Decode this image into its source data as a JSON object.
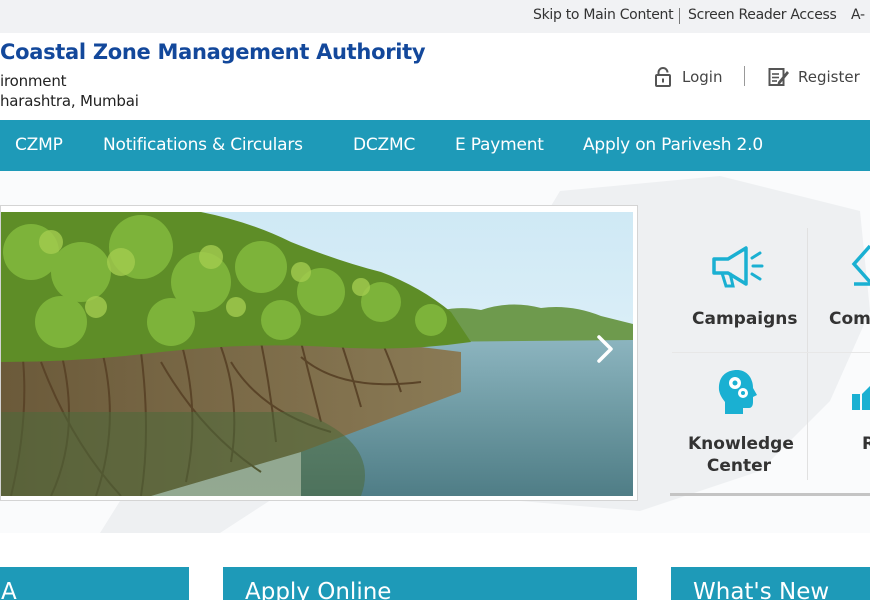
{
  "topbar": {
    "skip_link": "Skip to Main Content",
    "screen_reader": "Screen Reader Access",
    "font_decrease": "A-"
  },
  "header": {
    "title": "Coastal Zone Management Authority",
    "subtitle_1": "ironment",
    "subtitle_2": "harashtra, Mumbai",
    "login_label": "Login",
    "register_label": "Register",
    "icons": {
      "login": "lock-icon",
      "register": "register-note-icon"
    }
  },
  "nav": {
    "items": [
      {
        "label": "CZMP"
      },
      {
        "label": "Notifications & Circulars"
      },
      {
        "label": "DCZMC"
      },
      {
        "label": "E Payment"
      },
      {
        "label": "Apply on Parivesh 2.0"
      }
    ]
  },
  "slider": {
    "next_icon": "chevron-right-icon"
  },
  "quick_links": [
    {
      "label": "Campaigns",
      "icon": "megaphone-icon"
    },
    {
      "label": "Comp",
      "icon": "compliance-icon"
    },
    {
      "label_line1": "Knowledge",
      "label_line2": "Center",
      "icon": "head-gears-icon"
    },
    {
      "label": "R",
      "icon": "hand-icon"
    }
  ],
  "sections": {
    "left_title": "A",
    "middle_title": "Apply Online",
    "right_title": "What's New"
  },
  "colors": {
    "nav_bg": "#1e9ab8",
    "brand_title": "#13489b",
    "icon_accent": "#1ab0d2",
    "topbar_bg": "#f1f2f4"
  }
}
